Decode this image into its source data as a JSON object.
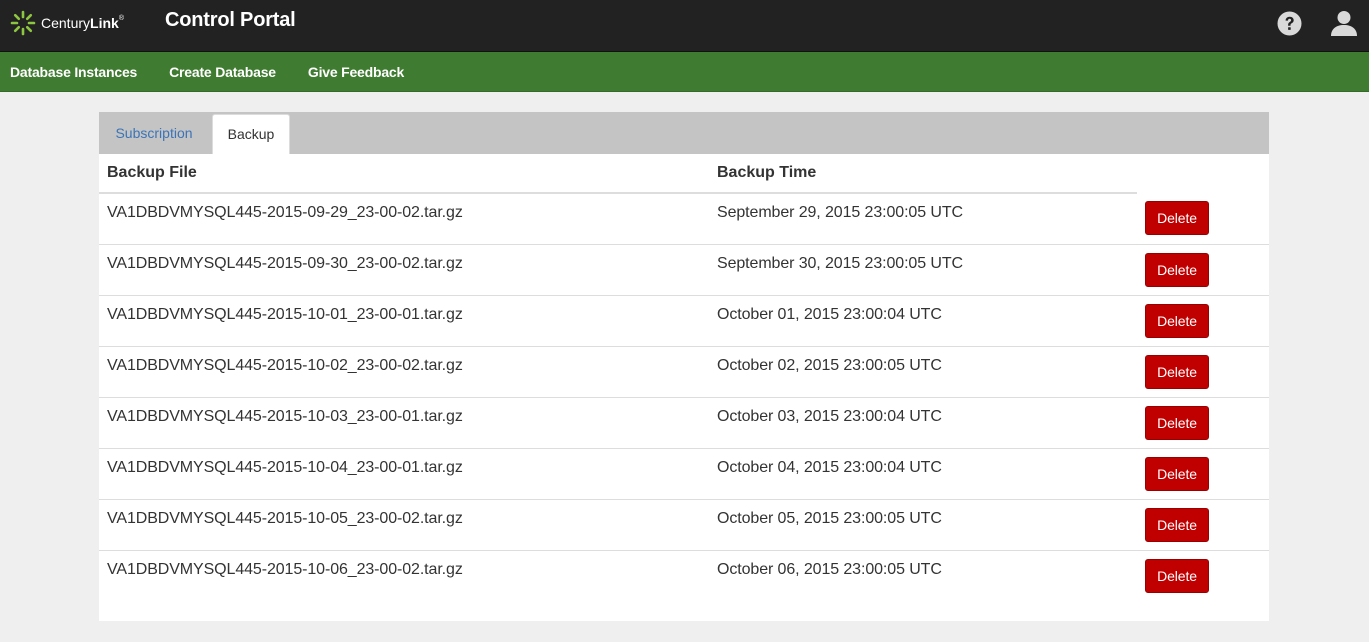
{
  "header": {
    "brand_prefix": "Century",
    "brand_bold": "Link",
    "brand_mark": "®",
    "title": "Control Portal",
    "help_icon": "question-circle-icon",
    "user_icon": "user-icon"
  },
  "nav": {
    "items": [
      {
        "label": "Database Instances"
      },
      {
        "label": "Create Database"
      },
      {
        "label": "Give Feedback"
      }
    ]
  },
  "tabs": [
    {
      "label": "Subscription",
      "active": false
    },
    {
      "label": "Backup",
      "active": true
    }
  ],
  "table": {
    "columns": [
      "Backup File",
      "Backup Time",
      ""
    ],
    "rows": [
      {
        "file": "VA1DBDVMYSQL445-2015-09-29_23-00-02.tar.gz",
        "time": "September 29, 2015 23:00:05 UTC",
        "action": "Delete"
      },
      {
        "file": "VA1DBDVMYSQL445-2015-09-30_23-00-02.tar.gz",
        "time": "September 30, 2015 23:00:05 UTC",
        "action": "Delete"
      },
      {
        "file": "VA1DBDVMYSQL445-2015-10-01_23-00-01.tar.gz",
        "time": "October 01, 2015 23:00:04 UTC",
        "action": "Delete"
      },
      {
        "file": "VA1DBDVMYSQL445-2015-10-02_23-00-02.tar.gz",
        "time": "October 02, 2015 23:00:05 UTC",
        "action": "Delete"
      },
      {
        "file": "VA1DBDVMYSQL445-2015-10-03_23-00-01.tar.gz",
        "time": "October 03, 2015 23:00:04 UTC",
        "action": "Delete"
      },
      {
        "file": "VA1DBDVMYSQL445-2015-10-04_23-00-01.tar.gz",
        "time": "October 04, 2015 23:00:04 UTC",
        "action": "Delete"
      },
      {
        "file": "VA1DBDVMYSQL445-2015-10-05_23-00-02.tar.gz",
        "time": "October 05, 2015 23:00:05 UTC",
        "action": "Delete"
      },
      {
        "file": "VA1DBDVMYSQL445-2015-10-06_23-00-02.tar.gz",
        "time": "October 06, 2015 23:00:05 UTC",
        "action": "Delete"
      }
    ]
  },
  "colors": {
    "header_bg": "#222222",
    "nav_bg": "#3f7b30",
    "tab_strip_bg": "#c4c4c4",
    "link_blue": "#3b74b8",
    "delete_red": "#c00000",
    "logo_green": "#8dc63f"
  }
}
